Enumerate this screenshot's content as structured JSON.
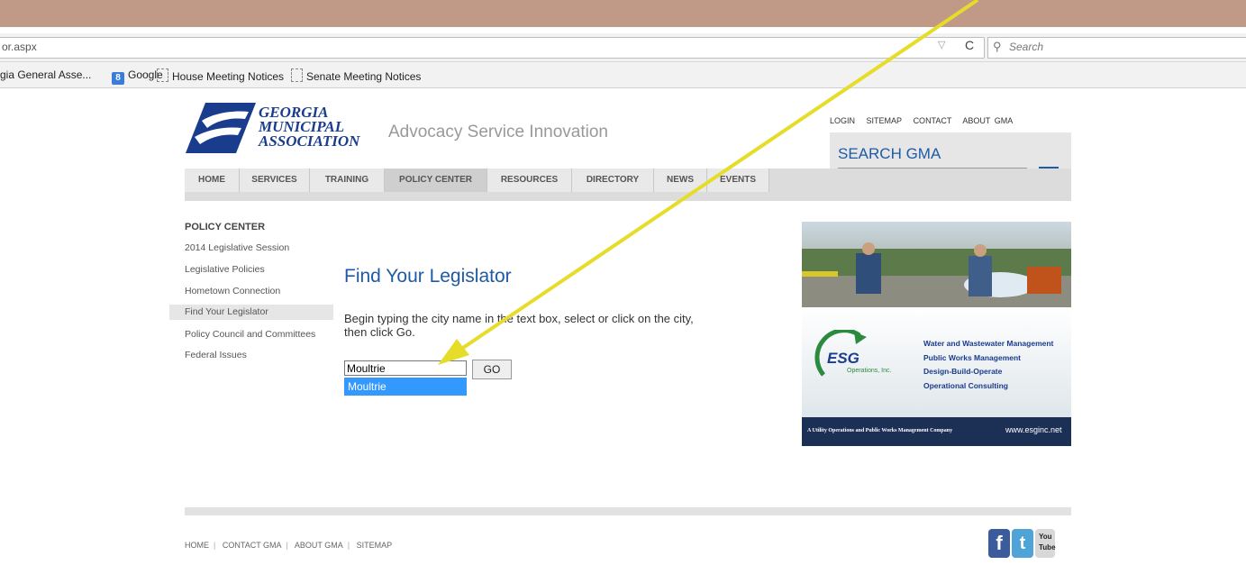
{
  "browser": {
    "url_fragment": "or.aspx",
    "search_placeholder": "Search",
    "bookmarks": [
      "gia General Asse...",
      "Google",
      "House Meeting Notices",
      "Senate Meeting Notices"
    ],
    "google_icon_letter": "8"
  },
  "header": {
    "logo_lines": [
      "GEORGIA",
      "MUNICIPAL",
      "ASSOCIATION"
    ],
    "tagline": "Advocacy   Service   Innovation",
    "toplinks": [
      "LOGIN",
      "SITEMAP",
      "CONTACT",
      "ABOUT GMA"
    ],
    "search_title": "SEARCH GMA",
    "search_button_icon": "arrow-right-icon"
  },
  "nav": {
    "tabs": [
      "HOME",
      "SERVICES",
      "TRAINING",
      "POLICY CENTER",
      "RESOURCES",
      "DIRECTORY",
      "NEWS",
      "EVENTS"
    ],
    "active": "POLICY CENTER"
  },
  "sidebar": {
    "heading": "POLICY CENTER",
    "items": [
      "2014 Legislative Session",
      "Legislative Policies",
      "Hometown Connection",
      "Find Your Legislator",
      "Policy Council and Committees",
      "Federal Issues"
    ],
    "active": "Find Your Legislator"
  },
  "main": {
    "title": "Find Your Legislator",
    "instructions": "Begin typing the city name in the text box, select or click on the city, then click Go.",
    "city_value": "Moultrie",
    "go_label": "GO",
    "suggestion": "Moultrie"
  },
  "ad": {
    "logo": "ESG",
    "logo_sub": "Operations, Inc.",
    "services": [
      "Water and Wastewater Management",
      "Public Works Management",
      "Design-Build-Operate",
      "Operational Consulting"
    ],
    "footer_left": "A Utility Operations and Public Works Management Company",
    "footer_right": "www.esginc.net"
  },
  "footer": {
    "links": [
      "HOME",
      "CONTACT GMA",
      "ABOUT GMA",
      "SITEMAP"
    ],
    "social": [
      "f",
      "t",
      "You Tube"
    ]
  },
  "colors": {
    "brand_blue": "#1f5aa6",
    "annotation_arrow": "#e6dc2a",
    "titlebar": "#c19a87"
  }
}
